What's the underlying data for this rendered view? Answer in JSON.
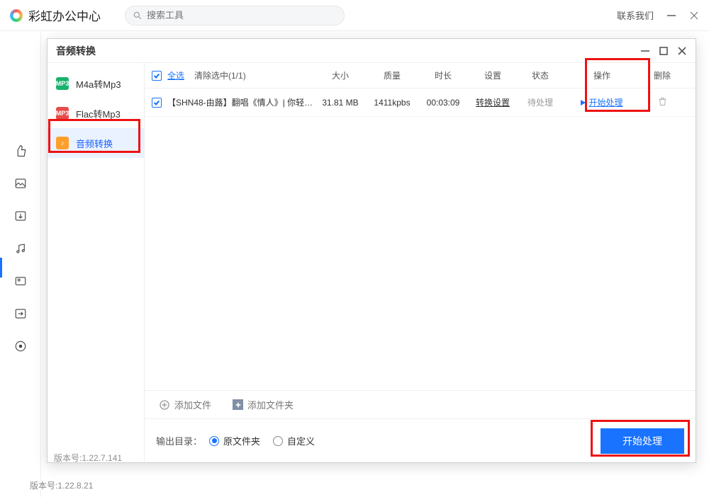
{
  "app": {
    "title": "彩虹办公中心",
    "search_placeholder": "搜索工具",
    "contact": "联系我们"
  },
  "bg_footer": {
    "version": "版本号:1.22.8.21",
    "item2": "···"
  },
  "dialog": {
    "title": "音频转换",
    "version": "版本号:1.22.7.141",
    "sidebar": {
      "items": [
        {
          "label": "M4a转Mp3",
          "icon": "MP3",
          "cls": "si-green"
        },
        {
          "label": "Flac转Mp3",
          "icon": "MP3",
          "cls": "si-red"
        },
        {
          "label": "音频转换",
          "icon": "♪",
          "cls": "si-orange"
        }
      ]
    },
    "columns": {
      "select_all": "全选",
      "clear_sel": "清除选中(1/1)",
      "size": "大小",
      "quality": "质量",
      "duration": "时长",
      "setting": "设置",
      "status": "状态",
      "action": "操作",
      "delete": "删除"
    },
    "rows": [
      {
        "checked": true,
        "name": "【SHN48-由蕗】翻唱《情人》| 你轻…",
        "size": "31.81 MB",
        "quality": "1411kpbs",
        "duration": "00:03:09",
        "setting": "转换设置",
        "status": "待处理",
        "action": "开始处理"
      }
    ],
    "addbar": {
      "add_file": "添加文件",
      "add_folder": "添加文件夹"
    },
    "footer": {
      "out_label": "输出目录：",
      "opt_src": "原文件夹",
      "opt_custom": "自定义",
      "start": "开始处理"
    }
  }
}
